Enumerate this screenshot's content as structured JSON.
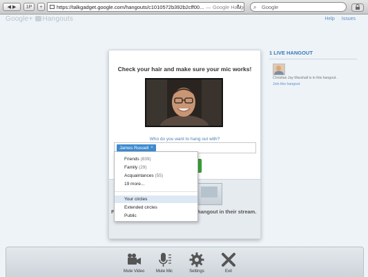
{
  "browser": {
    "url": "https://talkgadget.google.com/hangouts/c1010572b392b2cff00...",
    "page_title": "— Google Hangouts",
    "search_placeholder": "Google",
    "nav_back": "◀",
    "nav_forward": "▶",
    "pages_btn": "1P",
    "new_tab": "+",
    "reload": "↻"
  },
  "app": {
    "logo_text_google": "Google+",
    "logo_text_hangouts": "Hangouts",
    "links": [
      "Help",
      "Issues"
    ]
  },
  "dialog": {
    "headline": "Check your hair and make sure your mic works!",
    "question": "Who do you want to hang out with?",
    "chip_label": "James Russell",
    "chip_remove": "×",
    "lower_prefix": "F",
    "lower_text": "hangout in their stream."
  },
  "dropdown": {
    "items": [
      {
        "label": "Friends",
        "count": "(839)"
      },
      {
        "label": "Family",
        "count": "(29)"
      },
      {
        "label": "Acquaintances",
        "count": "(55)"
      },
      {
        "label": "19 more...",
        "count": ""
      },
      {
        "label": "Your circles",
        "count": "",
        "selected": true
      },
      {
        "label": "Extended circles",
        "count": ""
      },
      {
        "label": "Public",
        "count": ""
      }
    ]
  },
  "panel": {
    "heading": "1 LIVE HANGOUT",
    "info": "Christian Jay Marshall is in this hangout.",
    "join": "Join this hangout"
  },
  "toolbar": {
    "mute_video": "Mute Video",
    "mute_mic": "Mute Mic",
    "settings": "Settings",
    "exit": "Exit"
  },
  "colors": {
    "accent": "#3a79b6",
    "chip": "#3d8bd0",
    "green": "#3aa83a"
  }
}
